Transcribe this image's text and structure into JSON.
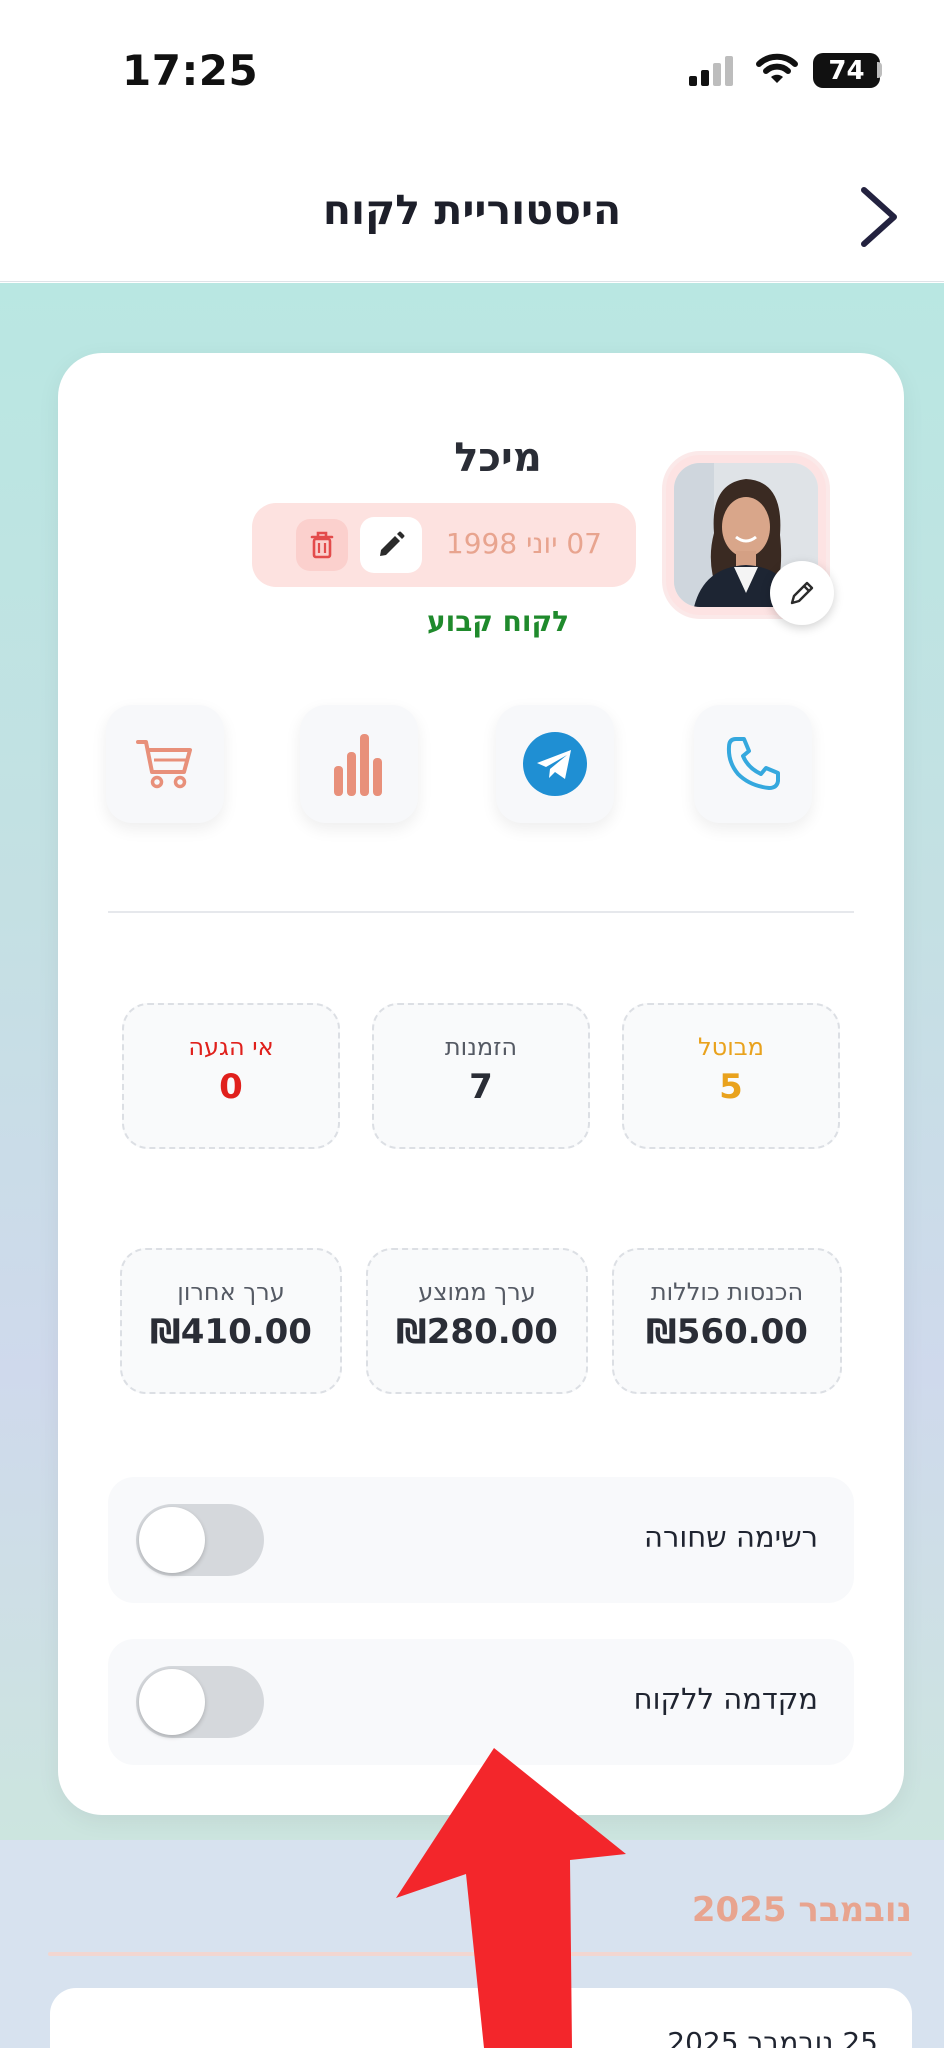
{
  "status_bar": {
    "time": "17:25",
    "battery": "74",
    "icons": [
      "signal-icon",
      "wifi-icon",
      "battery-icon"
    ]
  },
  "header": {
    "title": "היסטוריית לקוח",
    "back_icon": "chevron-right-icon"
  },
  "profile": {
    "name": "מיכל",
    "birthday": "07 יוני 1998",
    "status": "לקוח קבוע",
    "avatar_alt": "customer photo"
  },
  "actions": [
    {
      "name": "phone",
      "icon": "phone-icon"
    },
    {
      "name": "telegram",
      "icon": "telegram-icon"
    },
    {
      "name": "stats",
      "icon": "bar-chart-icon"
    },
    {
      "name": "cart",
      "icon": "cart-icon"
    }
  ],
  "stats": [
    {
      "label": "מבוטל",
      "value": "5",
      "color": "#e9a21d"
    },
    {
      "label": "הזמנות",
      "value": "7",
      "color": "#555a64"
    },
    {
      "label": "אי הגעה",
      "value": "0",
      "color": "#e0201c"
    }
  ],
  "money": [
    {
      "label": "הכנסות כוללות",
      "value": "₪560.00"
    },
    {
      "label": "ערך ממוצע",
      "value": "₪280.00"
    },
    {
      "label": "ערך אחרון",
      "value": "₪410.00"
    }
  ],
  "toggles": [
    {
      "label": "רשימה שחורה",
      "on": false
    },
    {
      "label": "מקדמה ללקוח",
      "on": false
    }
  ],
  "history": {
    "month": "נובמבר 2025",
    "first_date": "25 נובמבר 2025"
  },
  "colors": {
    "accent_salmon": "#e8a48f",
    "telegram_blue": "#1f8fd3",
    "phone_blue": "#35a8de",
    "status_green": "#1f8a2c",
    "arrow_red": "#f3262b"
  }
}
